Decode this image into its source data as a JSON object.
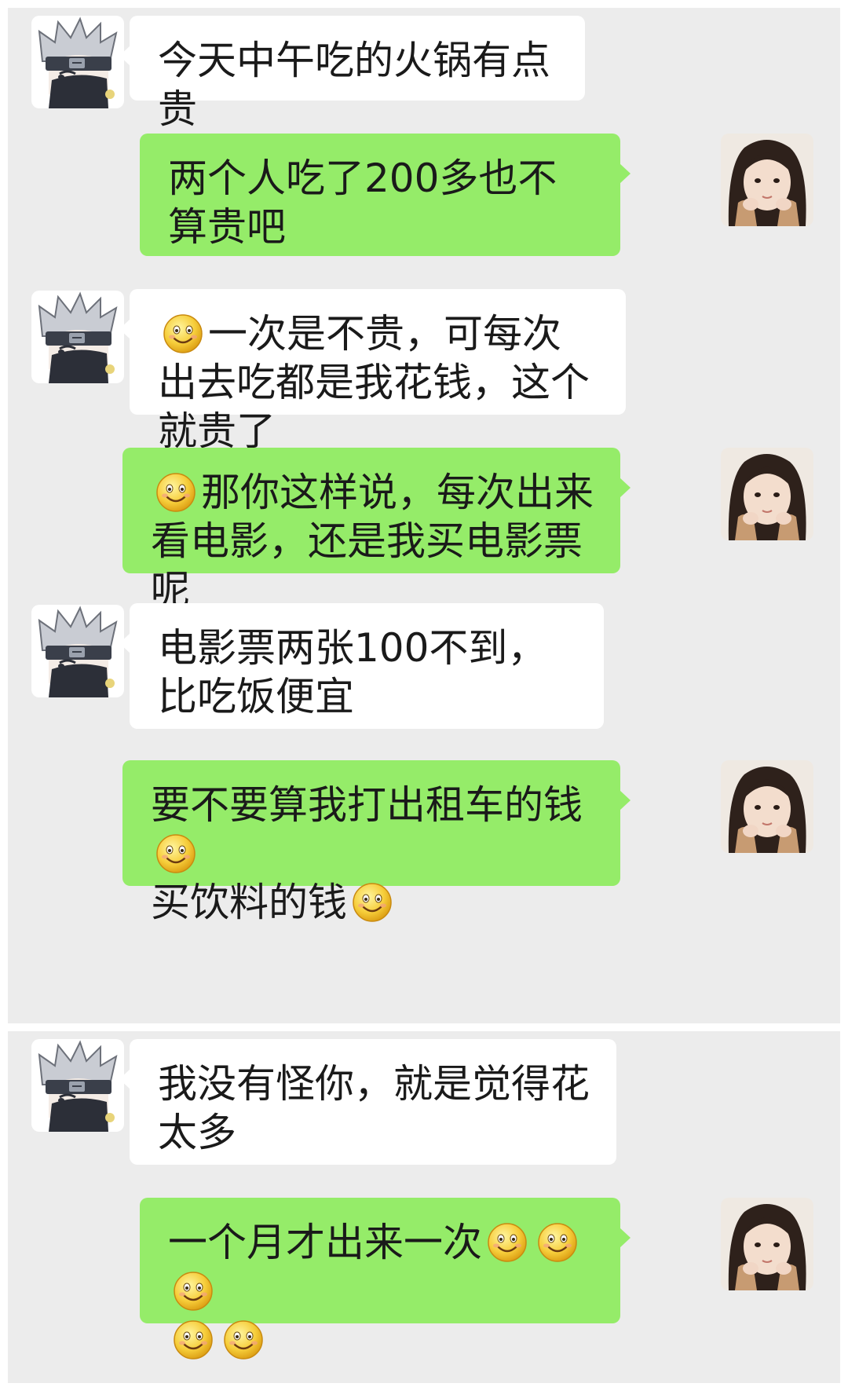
{
  "colors": {
    "background": "#ececec",
    "incoming_bubble": "#ffffff",
    "outgoing_bubble": "#95ec69"
  },
  "avatars": {
    "incoming": "anime-ninja-avatar",
    "outgoing": "girl-photo-avatar"
  },
  "messages": [
    {
      "side": "in",
      "text": "今天中午吃的火锅有点贵"
    },
    {
      "side": "out",
      "text": "两个人吃了200多也不算贵吧"
    },
    {
      "side": "in",
      "text_a": "一次是不贵，可每次出去吃都是我花钱，这个就贵了",
      "emoji": "smile-emoji"
    },
    {
      "side": "out",
      "text_a": "那你这样说，每次出来看电影，还是我买电影票呢",
      "emoji": "smile-emoji"
    },
    {
      "side": "in",
      "text": "电影票两张100不到，比吃饭便宜"
    },
    {
      "side": "out",
      "text_a": "要不要算我打出租车的钱",
      "text_b": "买饮料的钱",
      "emoji": "smile-emoji"
    },
    {
      "side": "in",
      "text": "我没有怪你，就是觉得花太多"
    },
    {
      "side": "out",
      "text_a": "一个月才出来一次",
      "emoji": "smile-emoji"
    }
  ]
}
